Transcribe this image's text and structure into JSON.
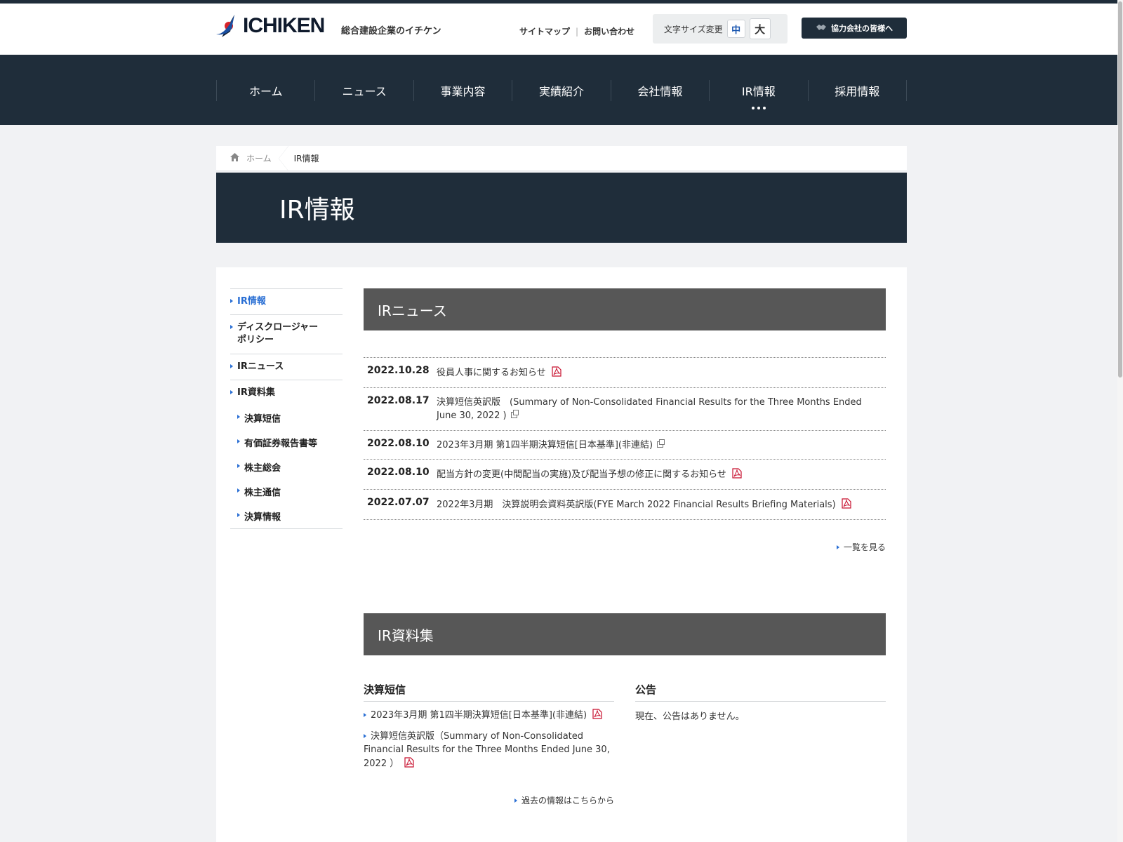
{
  "header": {
    "brand": "ICHIKEN",
    "tagline": "総合建設企業のイチケン",
    "sitemap": "サイトマップ",
    "contact": "お問い合わせ",
    "font_size_label": "文字サイズ変更",
    "font_medium": "中",
    "font_large": "大",
    "partner_button": "協力会社の皆様へ"
  },
  "nav": {
    "items": [
      "ホーム",
      "ニュース",
      "事業内容",
      "実績紹介",
      "会社情報",
      "IR情報",
      "採用情報"
    ]
  },
  "breadcrumb": {
    "home": "ホーム",
    "current": "IR情報"
  },
  "page_title": "IR情報",
  "side_nav": {
    "items": [
      {
        "label": "IR情報"
      },
      {
        "label": "ディスクロージャー\nポリシー"
      },
      {
        "label": "IRニュース"
      },
      {
        "label": "IR資料集"
      }
    ],
    "sub_items": [
      "決算短信",
      "有価証券報告書等",
      "株主総会",
      "株主通信",
      "決算情報"
    ]
  },
  "ir_news": {
    "heading": "IRニュース",
    "rows": [
      {
        "date": "2022.10.28",
        "title": "役員人事に関するお知らせ"
      },
      {
        "date": "2022.08.17",
        "title": "決算短信英訳版　(Summary of Non-Consolidated Financial Results for the Three Months Ended June 30, 2022 )"
      },
      {
        "date": "2022.08.10",
        "title": "2023年3月期 第1四半期決算短信[日本基準](非連結)"
      },
      {
        "date": "2022.08.10",
        "title": "配当方針の変更(中間配当の実施)及び配当予想の修正に関するお知らせ"
      },
      {
        "date": "2022.07.07",
        "title": "2022年3月期　決算説明会資料英訳版(FYE March 2022 Financial Results Briefing Materials)"
      }
    ],
    "more": "一覧を見る"
  },
  "ir_library": {
    "heading": "IR資料集",
    "kessan": {
      "heading": "決算短信",
      "items": [
        "2023年3月期 第1四半期決算短信[日本基準](非連結)",
        "決算短信英訳版（Summary of Non-Consolidated Financial Results for the Three Months Ended June 30, 2022 ）"
      ],
      "past": "過去の情報はこちらから"
    },
    "notice": {
      "heading": "公告",
      "text": "現在、公告はありません。"
    }
  }
}
